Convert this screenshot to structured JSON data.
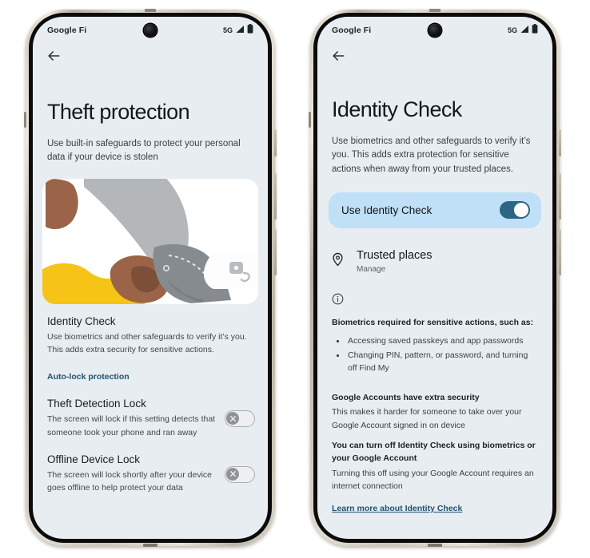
{
  "phones": [
    {
      "id": "theft-protection",
      "status_bar": {
        "carrier": "Google Fi",
        "network": "5G",
        "signal_icon": "signal-bars-icon",
        "battery_icon": "battery-icon",
        "camera_icon": "front-camera-icon"
      },
      "back_icon": "back-arrow-icon",
      "title": "Theft protection",
      "subtitle": "Use built-in safeguards to protect your personal data if your device is stolen",
      "illustration": {
        "name": "thief-grabbing-phone-illustration",
        "colors": {
          "background": "#ffffff",
          "brown": "#9b6347",
          "brown_dark": "#7d4e38",
          "yellow": "#f6c317",
          "gray_sleeve": "#b4b7ba",
          "gray_glove": "#868b90",
          "phone_white": "#fdfdfd",
          "lock_gray": "#b9bdc1"
        }
      },
      "sections": [
        {
          "title": "Identity Check",
          "body": "Use biometrics and other safeguards to verify it’s you. This adds extra security for sensitive actions."
        }
      ],
      "link": "Auto-lock protection",
      "toggles": [
        {
          "title": "Theft Detection Lock",
          "body": "The screen will lock if this setting detects that someone took your phone and ran away",
          "state": "off"
        },
        {
          "title": "Offline Device Lock",
          "body": "The screen will lock shortly after your device goes offline to help protect your data",
          "state": "off"
        }
      ]
    },
    {
      "id": "identity-check",
      "status_bar": {
        "carrier": "Google Fi",
        "network": "5G",
        "signal_icon": "signal-bars-icon",
        "battery_icon": "battery-icon",
        "camera_icon": "front-camera-icon"
      },
      "back_icon": "back-arrow-icon",
      "title": "Identity Check",
      "subtitle": "Use biometrics and other safeguards to verify it’s you. This adds extra protection for sensitive actions when away from your trusted places.",
      "main_toggle": {
        "label": "Use Identity Check",
        "state": "on",
        "track_color": "#2b6684",
        "card_color": "#bfe0f6"
      },
      "trusted_places": {
        "icon": "location-pin-icon",
        "title": "Trusted places",
        "subtitle": "Manage"
      },
      "info_icon": "info-circle-icon",
      "info_blocks": [
        {
          "head": "Biometrics required for sensitive actions, such as:",
          "bullets": [
            "Accessing saved passkeys and app passwords",
            "Changing PIN, pattern, or password, and turning off Find My"
          ]
        },
        {
          "head": "Google Accounts have extra security",
          "text": "This makes it harder for someone to take over your Google Account signed in on device"
        },
        {
          "head": "You can turn off Identity Check using biometrics or your Google Account",
          "text": "Turning this off using your Google Account requires an internet connection"
        }
      ],
      "link": "Learn more about Identity Check"
    }
  ]
}
